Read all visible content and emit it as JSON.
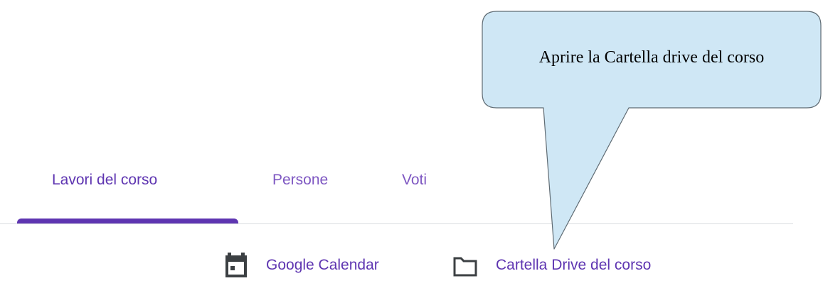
{
  "tabs": [
    {
      "label": "Lavori del corso",
      "active": true
    },
    {
      "label": "Persone",
      "active": false
    },
    {
      "label": "Voti",
      "active": false
    }
  ],
  "links": {
    "calendar": {
      "label": "Google Calendar",
      "icon": "calendar-icon"
    },
    "drive": {
      "label": "Cartella Drive del corso",
      "icon": "folder-icon"
    }
  },
  "callout": {
    "text": "Aprire la Cartella drive del corso"
  },
  "colors": {
    "accent": "#5e35b1",
    "tab_text": "#7e57c2",
    "icon": "#3c4043",
    "divider": "#dadce0",
    "callout_fill": "#cfe7f5",
    "callout_border": "#5f6b73"
  }
}
